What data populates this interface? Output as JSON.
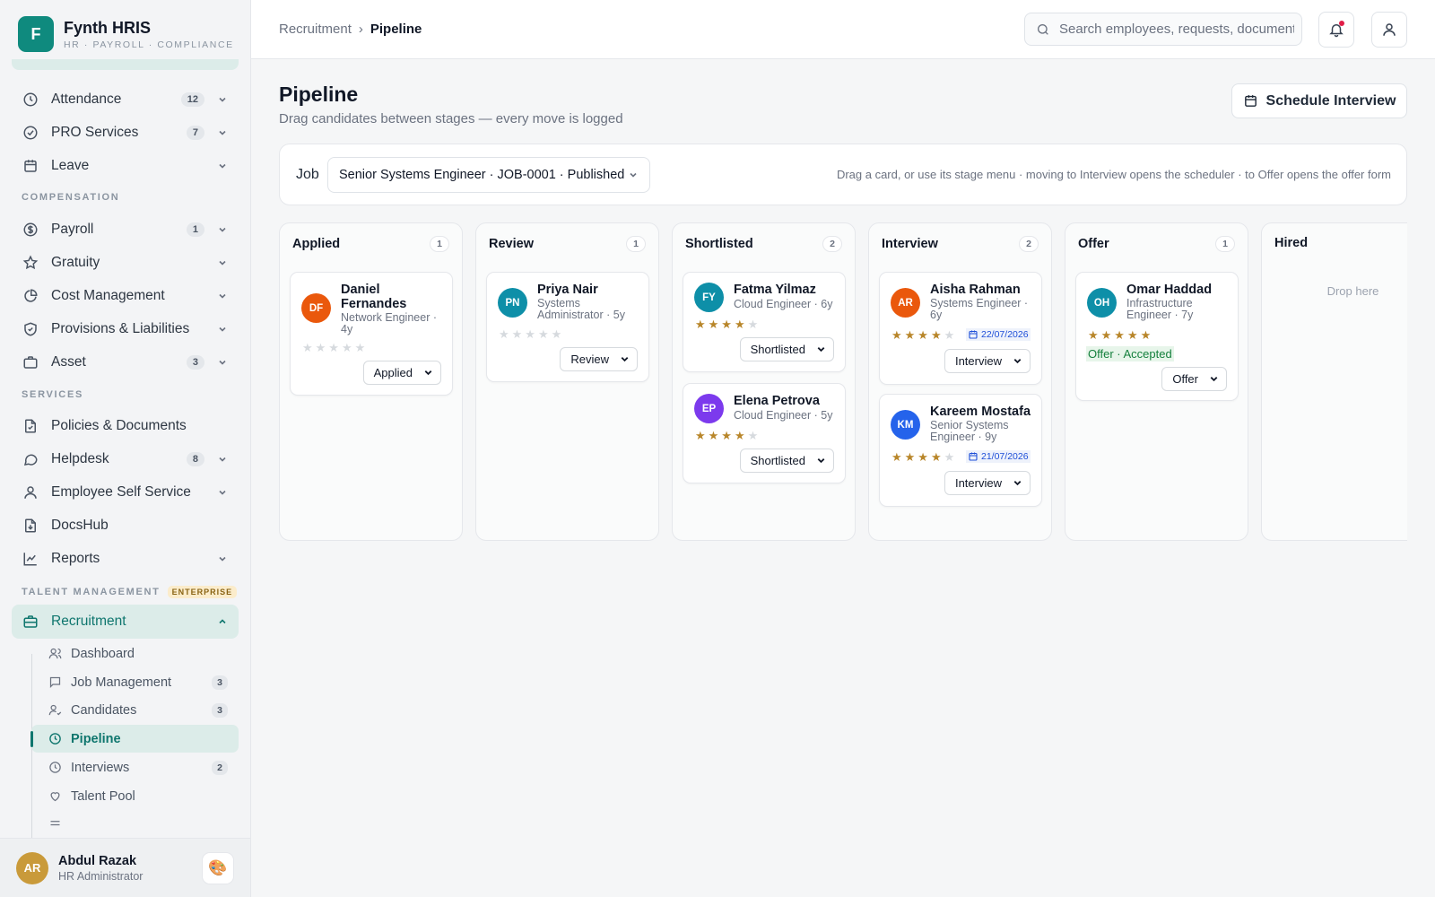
{
  "brand": {
    "initial": "F",
    "name": "Fynth HRIS",
    "subtitle": "HR · PAYROLL · COMPLIANCE"
  },
  "sidebar": {
    "items": [
      {
        "label": "Attendance",
        "count": "12",
        "icon": "clock-icon"
      },
      {
        "label": "PRO Services",
        "count": "7",
        "icon": "check-circle-icon"
      },
      {
        "label": "Leave",
        "count": "",
        "icon": "calendar-icon"
      },
      {
        "label": "Payroll",
        "count": "1",
        "icon": "dollar-circle-icon"
      },
      {
        "label": "Gratuity",
        "count": "",
        "icon": "star-icon"
      },
      {
        "label": "Cost Management",
        "count": "",
        "icon": "pie-chart-icon"
      },
      {
        "label": "Provisions & Liabilities",
        "count": "",
        "icon": "shield-check-icon"
      },
      {
        "label": "Asset",
        "count": "3",
        "icon": "briefcase-icon"
      },
      {
        "label": "Policies & Documents",
        "count": "",
        "icon": "file-check-icon"
      },
      {
        "label": "Helpdesk",
        "count": "8",
        "icon": "chat-bubble-icon"
      },
      {
        "label": "Employee Self Service",
        "count": "",
        "icon": "user-icon"
      },
      {
        "label": "DocsHub",
        "count": "",
        "icon": "file-download-icon"
      },
      {
        "label": "Reports",
        "count": "",
        "icon": "line-chart-icon"
      },
      {
        "label": "Recruitment",
        "count": "",
        "icon": "briefcase-icon"
      }
    ],
    "sections": {
      "compensation": "COMPENSATION",
      "services": "SERVICES",
      "talent": "TALENT MANAGEMENT",
      "talent_badge": "ENTERPRISE"
    },
    "recruitment_sub": [
      {
        "label": "Dashboard",
        "count": ""
      },
      {
        "label": "Job Management",
        "count": "3"
      },
      {
        "label": "Candidates",
        "count": "3"
      },
      {
        "label": "Pipeline",
        "count": ""
      },
      {
        "label": "Interviews",
        "count": "2"
      },
      {
        "label": "Talent Pool",
        "count": ""
      }
    ]
  },
  "user": {
    "initials": "AR",
    "name": "Abdul Razak",
    "role": "HR Administrator",
    "theme_icon": "🎨"
  },
  "topbar": {
    "breadcrumb": {
      "parent": "Recruitment",
      "separator": "›",
      "current": "Pipeline"
    },
    "search_placeholder": "Search employees, requests, documents..."
  },
  "page": {
    "title": "Pipeline",
    "subtitle": "Drag candidates between stages — every move is logged",
    "schedule_button": "Schedule Interview",
    "job_label": "Job",
    "job_selected": "Senior Systems Engineer · JOB-0001 · Published",
    "hint": "Drag a card, or use its stage menu · moving to Interview opens the scheduler · to Offer opens the offer form"
  },
  "board": {
    "drop_text": "Drop here",
    "columns": [
      {
        "title": "Applied",
        "count": "1"
      },
      {
        "title": "Review",
        "count": "1"
      },
      {
        "title": "Shortlisted",
        "count": "2"
      },
      {
        "title": "Interview",
        "count": "2"
      },
      {
        "title": "Offer",
        "count": "1"
      },
      {
        "title": "Hired",
        "count": ""
      }
    ],
    "cards": {
      "daniel": {
        "initials": "DF",
        "name": "Daniel Fernandes",
        "role": "Network Engineer · 4y",
        "rating": 0,
        "stage": "Applied",
        "color": "#ea580c"
      },
      "priya": {
        "initials": "PN",
        "name": "Priya Nair",
        "role": "Systems Administrator · 5y",
        "rating": 0,
        "stage": "Review",
        "color": "#0e8fa8"
      },
      "fatma": {
        "initials": "FY",
        "name": "Fatma Yilmaz",
        "role": "Cloud Engineer · 6y",
        "rating": 4,
        "stage": "Shortlisted",
        "color": "#0e8fa8"
      },
      "elena": {
        "initials": "EP",
        "name": "Elena Petrova",
        "role": "Cloud Engineer · 5y",
        "rating": 4,
        "stage": "Shortlisted",
        "color": "#7c3aed"
      },
      "aisha": {
        "initials": "AR",
        "name": "Aisha Rahman",
        "role": "Systems Engineer · 6y",
        "rating": 4,
        "stage": "Interview",
        "date": "22/07/2026",
        "color": "#ea580c"
      },
      "kareem": {
        "initials": "KM",
        "name": "Kareem Mostafa",
        "role": "Senior Systems Engineer · 9y",
        "rating": 4,
        "stage": "Interview",
        "date": "21/07/2026",
        "color": "#2563eb"
      },
      "omar": {
        "initials": "OH",
        "name": "Omar Haddad",
        "role": "Infrastructure Engineer · 7y",
        "rating": 5,
        "stage": "Offer",
        "offer_status": "Offer · Accepted",
        "color": "#0e8fa8"
      }
    },
    "star_glyphs": {
      "filled": "★★★★",
      "five": "★★★★★",
      "empty": "★★★★★",
      "one": "★"
    }
  },
  "colors": {
    "accent": "#0f766e",
    "brand": "#0f8a7e",
    "star": "#b8862a",
    "offer_green": "#15803d",
    "date_blue": "#1d4ed8"
  }
}
